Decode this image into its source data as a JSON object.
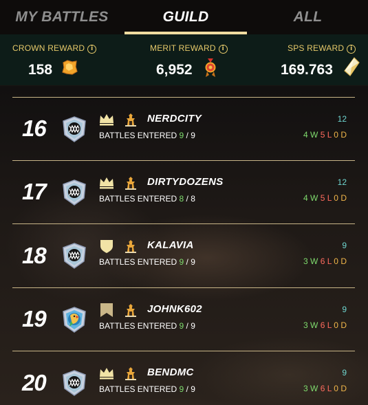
{
  "tabs": [
    {
      "label": "MY BATTLES",
      "active": false
    },
    {
      "label": "GUILD",
      "active": true
    },
    {
      "label": "ALL",
      "active": false
    }
  ],
  "rewards": {
    "crown": {
      "label": "CROWN REWARD",
      "value": "158",
      "icon": "crown-token-icon"
    },
    "merit": {
      "label": "MERIT REWARD",
      "value": "6,952",
      "icon": "merit-medal-icon"
    },
    "sps": {
      "label": "SPS REWARD",
      "value": "169.763",
      "icon": "sps-crystal-icon"
    }
  },
  "info_glyph": "i",
  "rows": [
    {
      "rank": "16",
      "player": "NERDCITY",
      "entered_label": "BATTLES ENTERED",
      "entered": "9",
      "sep": "/",
      "total": "9",
      "score": "12",
      "wins": "4",
      "w": "W",
      "losses": "5",
      "l": "L",
      "draws": "0",
      "d": "D",
      "tier": "crown",
      "badge": "fang-shield"
    },
    {
      "rank": "17",
      "player": "DIRTYDOZENS",
      "entered_label": "BATTLES ENTERED",
      "entered": "8",
      "sep": "/",
      "total": "8",
      "score": "12",
      "wins": "4",
      "w": "W",
      "losses": "5",
      "l": "L",
      "draws": "0",
      "d": "D",
      "tier": "crown",
      "badge": "fang-shield"
    },
    {
      "rank": "18",
      "player": "KALAVIA",
      "entered_label": "BATTLES ENTERED",
      "entered": "9",
      "sep": "/",
      "total": "9",
      "score": "9",
      "wins": "3",
      "w": "W",
      "losses": "6",
      "l": "L",
      "draws": "0",
      "d": "D",
      "tier": "shield",
      "badge": "fang-shield"
    },
    {
      "rank": "19",
      "player": "JOHNK602",
      "entered_label": "BATTLES ENTERED",
      "entered": "9",
      "sep": "/",
      "total": "9",
      "score": "9",
      "wins": "3",
      "w": "W",
      "losses": "6",
      "l": "L",
      "draws": "0",
      "d": "D",
      "tier": "banner",
      "badge": "parrot-shield"
    },
    {
      "rank": "20",
      "player": "BENDMC",
      "entered_label": "BATTLES ENTERED",
      "entered": "9",
      "sep": "/",
      "total": "9",
      "score": "9",
      "wins": "3",
      "w": "W",
      "losses": "6",
      "l": "L",
      "draws": "0",
      "d": "D",
      "tier": "crown",
      "badge": "fang-shield"
    }
  ],
  "colors": {
    "accent": "#f0dca0",
    "reward_label": "#e6c96a",
    "win": "#7fdc6e",
    "loss": "#ff6b5e",
    "draw": "#f0b64a",
    "score": "#6fd6d0"
  }
}
